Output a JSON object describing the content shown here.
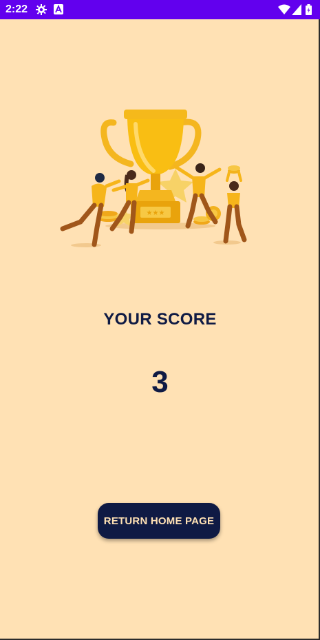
{
  "status_bar": {
    "time": "2:22",
    "icons": [
      "gear-icon",
      "a-badge-icon",
      "wifi-icon",
      "signal-icon",
      "battery-icon"
    ],
    "background": "#6200EE"
  },
  "illustration": {
    "icon": "trophy-celebration-illustration"
  },
  "result": {
    "title": "YOUR SCORE",
    "score": "3"
  },
  "actions": {
    "return_home_label": "RETURN HOME PAGE"
  },
  "colors": {
    "background": "#FFE1B4",
    "primary_text": "#0F1A44",
    "button_bg": "#0F1A44",
    "accent": "#F9B90A"
  }
}
